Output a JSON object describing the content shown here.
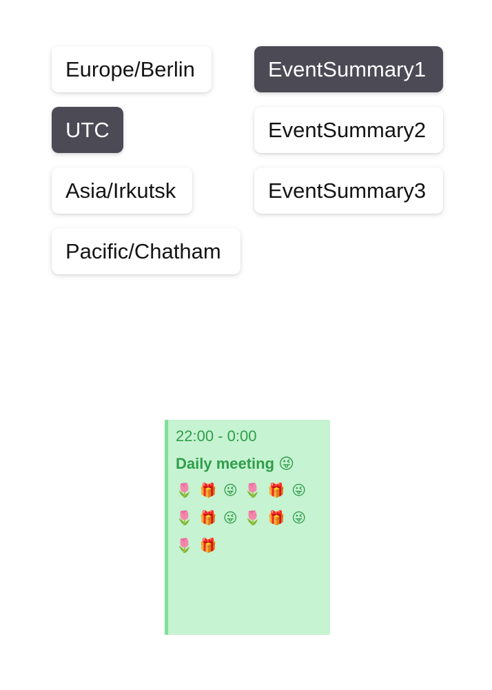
{
  "timezones": [
    {
      "label": "Europe/Berlin",
      "selected": false
    },
    {
      "label": "UTC",
      "selected": true
    },
    {
      "label": "Asia/Irkutsk",
      "selected": false
    },
    {
      "label": "Pacific/Chatham",
      "selected": false
    }
  ],
  "events": [
    {
      "label": "EventSummary1",
      "selected": true
    },
    {
      "label": "EventSummary2",
      "selected": false
    },
    {
      "label": "EventSummary3",
      "selected": false
    }
  ],
  "event_card": {
    "time": "22:00 - 0:00",
    "title": "Daily meeting 😜",
    "description_lines": [
      "🌷 🎁 😜 🌷 🎁 😜",
      "🌷 🎁 😜 🌷 🎁 😜",
      "🌷 🎁"
    ]
  },
  "colors": {
    "selected_bg": "#4b4a55",
    "event_bg": "#c6f3d1",
    "event_border": "#7ee09a",
    "event_text": "#2f9d4b"
  }
}
